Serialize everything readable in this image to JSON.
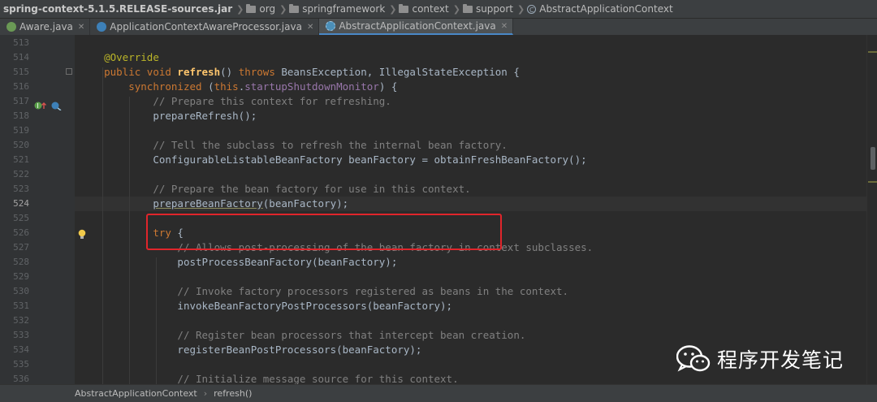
{
  "breadcrumb": {
    "items": [
      {
        "label": "spring-context-5.1.5.RELEASE-sources.jar",
        "icon": "jar"
      },
      {
        "label": "org",
        "icon": "folder-icon"
      },
      {
        "label": "springframework",
        "icon": "folder-icon"
      },
      {
        "label": "context",
        "icon": "folder-icon"
      },
      {
        "label": "support",
        "icon": "folder-icon"
      },
      {
        "label": "AbstractApplicationContext",
        "icon": "class-icon"
      }
    ]
  },
  "tabs": [
    {
      "label": "Aware.java",
      "icon": "interface-icon",
      "active": false
    },
    {
      "label": "ApplicationContextAwareProcessor.java",
      "icon": "class-icon",
      "active": false
    },
    {
      "label": "AbstractApplicationContext.java",
      "icon": "abstract-class-icon",
      "active": true
    }
  ],
  "editor": {
    "lines": [
      {
        "num": "513"
      },
      {
        "num": "514",
        "t": [
          [
            "    ",
            ""
          ],
          [
            "@Override",
            "ann"
          ]
        ]
      },
      {
        "num": "515",
        "t": [
          [
            "    ",
            ""
          ],
          [
            "public void ",
            "kw"
          ],
          [
            "refresh",
            "fn"
          ],
          [
            "() ",
            ""
          ],
          [
            "throws ",
            "kw"
          ],
          [
            "BeansException, IllegalStateException {",
            ""
          ]
        ]
      },
      {
        "num": "516",
        "t": [
          [
            "        ",
            ""
          ],
          [
            "synchronized ",
            "kw"
          ],
          [
            "(",
            ""
          ],
          [
            "this",
            "kw"
          ],
          [
            ".",
            ""
          ],
          [
            "startupShutdownMonitor",
            "fld"
          ],
          [
            ") {",
            ""
          ]
        ]
      },
      {
        "num": "517",
        "t": [
          [
            "            ",
            ""
          ],
          [
            "// Prepare this context for refreshing.",
            "cm"
          ]
        ]
      },
      {
        "num": "518",
        "t": [
          [
            "            ",
            ""
          ],
          [
            "prepareRefresh();",
            ""
          ]
        ]
      },
      {
        "num": "519"
      },
      {
        "num": "520",
        "t": [
          [
            "            ",
            ""
          ],
          [
            "// Tell the subclass to refresh the internal bean factory.",
            "cm"
          ]
        ]
      },
      {
        "num": "521",
        "t": [
          [
            "            ",
            ""
          ],
          [
            "ConfigurableListableBeanFactory beanFactory = obtainFreshBeanFactory();",
            ""
          ]
        ]
      },
      {
        "num": "522"
      },
      {
        "num": "523",
        "t": [
          [
            "            ",
            ""
          ],
          [
            "// Prepare the bean factory for use in this context.",
            "cm"
          ]
        ]
      },
      {
        "num": "524",
        "t": [
          [
            "            ",
            ""
          ],
          [
            "prepareBeanFactory",
            "squig"
          ],
          [
            "(beanFactory);",
            ""
          ]
        ],
        "current": true
      },
      {
        "num": "525"
      },
      {
        "num": "526",
        "t": [
          [
            "            ",
            ""
          ],
          [
            "try ",
            "kw"
          ],
          [
            "{",
            ""
          ]
        ]
      },
      {
        "num": "527",
        "t": [
          [
            "                ",
            ""
          ],
          [
            "// Allows post-processing of the bean factory in context subclasses.",
            "cm"
          ]
        ]
      },
      {
        "num": "528",
        "t": [
          [
            "                ",
            ""
          ],
          [
            "postProcessBeanFactory(beanFactory);",
            ""
          ]
        ]
      },
      {
        "num": "529"
      },
      {
        "num": "530",
        "t": [
          [
            "                ",
            ""
          ],
          [
            "// Invoke factory processors registered as beans in the context.",
            "cm"
          ]
        ]
      },
      {
        "num": "531",
        "t": [
          [
            "                ",
            ""
          ],
          [
            "invokeBeanFactoryPostProcessors(beanFactory);",
            ""
          ]
        ]
      },
      {
        "num": "532"
      },
      {
        "num": "533",
        "t": [
          [
            "                ",
            ""
          ],
          [
            "// Register bean processors that intercept bean creation.",
            "cm"
          ]
        ]
      },
      {
        "num": "534",
        "t": [
          [
            "                ",
            ""
          ],
          [
            "registerBeanPostProcessors(beanFactory);",
            ""
          ]
        ]
      },
      {
        "num": "535"
      },
      {
        "num": "536",
        "t": [
          [
            "                ",
            ""
          ],
          [
            "// Initialize message source for this context.",
            "cm"
          ]
        ]
      }
    ]
  },
  "status": {
    "class_name": "AbstractApplicationContext",
    "method_name": "refresh()"
  },
  "watermark": {
    "text": "程序开发笔记"
  },
  "colors": {
    "background": "#2b2b2b",
    "keyword": "#cc7832",
    "annotation": "#bbb529",
    "method": "#ffc66d",
    "comment": "#808080",
    "field": "#9876aa",
    "highlight_box": "#e0252b"
  }
}
